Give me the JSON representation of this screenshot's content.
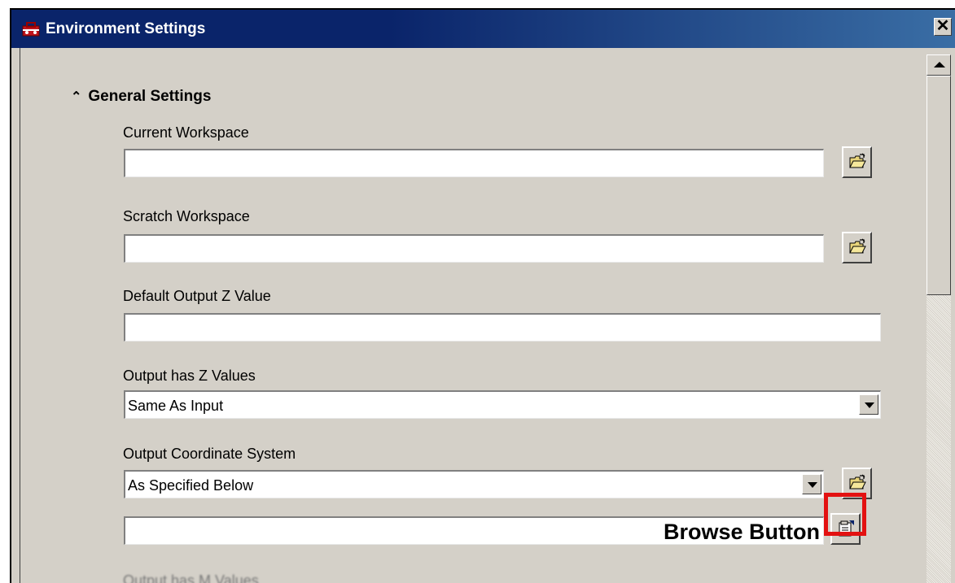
{
  "window": {
    "title": "Environment Settings",
    "close_symbol": "✕"
  },
  "section": {
    "title": "General Settings",
    "icon": "collapse-chevron-icon"
  },
  "fields": {
    "current_workspace": {
      "label": "Current Workspace",
      "value": ""
    },
    "scratch_workspace": {
      "label": "Scratch Workspace",
      "value": ""
    },
    "default_z": {
      "label": "Default Output Z Value",
      "value": ""
    },
    "output_has_z": {
      "label": "Output has Z Values",
      "value": "Same As Input"
    },
    "output_coord": {
      "label": "Output Coordinate System",
      "value": "As Specified Below"
    },
    "coord_path": {
      "value": ""
    },
    "next_label": "Output has M Values"
  },
  "annotation": {
    "text": "Browse Button",
    "color": "#e31111"
  },
  "colors": {
    "titlebar": "#0a246a",
    "face": "#d4d0c8"
  }
}
